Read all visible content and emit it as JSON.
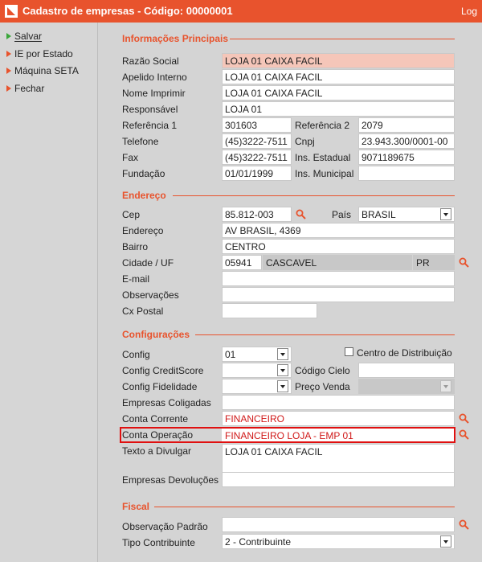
{
  "window": {
    "title": "Cadastro de empresas - Código: 00000001",
    "log_label": "Log"
  },
  "sidebar": {
    "items": [
      {
        "label": "Salvar"
      },
      {
        "label": "IE por Estado"
      },
      {
        "label": "Máquina SETA"
      },
      {
        "label": "Fechar"
      }
    ]
  },
  "info": {
    "title": "Informações Principais",
    "razao_label": "Razão Social",
    "razao_value": "LOJA 01 CAIXA FACIL",
    "apelido_label": "Apelido Interno",
    "apelido_value": "LOJA 01 CAIXA FACIL",
    "nome_label": "Nome Imprimir",
    "nome_value": "LOJA 01 CAIXA FACIL",
    "resp_label": "Responsável",
    "resp_value": "LOJA 01",
    "ref1_label": "Referência 1",
    "ref1_value": "301603",
    "ref2_label": "Referência 2",
    "ref2_value": "2079",
    "tel_label": "Telefone",
    "tel_value": "(45)3222-7511",
    "cnpj_label": "Cnpj",
    "cnpj_value": "23.943.300/0001-00",
    "fax_label": "Fax",
    "fax_value": "(45)3222-7511",
    "ie_label": "Ins. Estadual",
    "ie_value": "9071189675",
    "fund_label": "Fundação",
    "fund_value": "01/01/1999",
    "im_label": "Ins. Municipal",
    "im_value": ""
  },
  "address": {
    "title": "Endereço",
    "cep_label": "Cep",
    "cep_value": "85.812-003",
    "pais_label": "País",
    "pais_value": "BRASIL",
    "end_label": "Endereço",
    "end_value": "AV BRASIL, 4369",
    "bairro_label": "Bairro",
    "bairro_value": "CENTRO",
    "cidade_label": "Cidade / UF",
    "cidade_code": "05941",
    "cidade_name": "CASCAVEL",
    "uf": "PR",
    "email_label": "E-mail",
    "email_value": "",
    "obs_label": "Observações",
    "obs_value": "",
    "cx_label": "Cx Postal",
    "cx_value": ""
  },
  "config": {
    "title": "Configurações",
    "config_label": "Config",
    "config_value": "01",
    "cd_label": "Centro de Distribuição",
    "credit_label": "Config CreditScore",
    "credit_value": "",
    "cielo_label": "Código Cielo",
    "cielo_value": "",
    "fid_label": "Config Fidelidade",
    "fid_value": "",
    "preco_label": "Preço Venda",
    "preco_value": "",
    "coligadas_label": "Empresas Coligadas",
    "coligadas_value": "",
    "conta_corrente_label": "Conta Corrente",
    "conta_corrente_value": "FINANCEIRO",
    "conta_operacao_label": "Conta Operação",
    "conta_operacao_value": "FINANCEIRO LOJA - EMP 01",
    "texto_label": "Texto a Divulgar",
    "texto_value": "LOJA 01 CAIXA FACIL",
    "devol_label": "Empresas Devoluções",
    "devol_value": ""
  },
  "fiscal": {
    "title": "Fiscal",
    "obs_label": "Observação Padrão",
    "obs_value": "",
    "tipo_label": "Tipo Contribuinte",
    "tipo_value": "2 - Contribuinte"
  },
  "colors": {
    "accent": "#e8532d",
    "highlight": "#e01010",
    "pink_field": "#f5c6b9"
  }
}
